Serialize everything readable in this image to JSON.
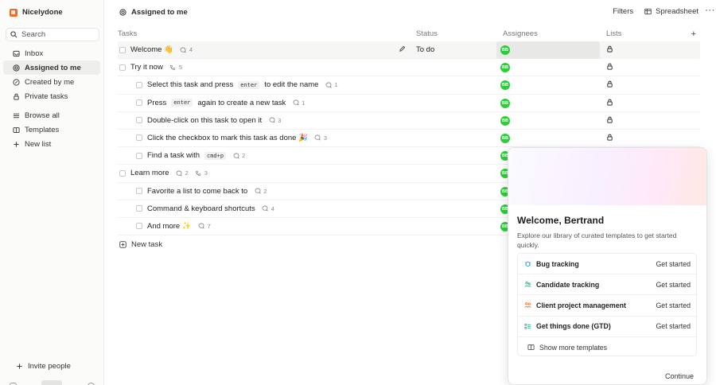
{
  "sidebar": {
    "workspace": "Nicelydone",
    "search_label": "Search",
    "items": [
      {
        "label": "Inbox",
        "icon": "inbox-icon"
      },
      {
        "label": "Assigned to me",
        "icon": "target-icon",
        "active": true
      },
      {
        "label": "Created by me",
        "icon": "pencil-circle-icon"
      },
      {
        "label": "Private tasks",
        "icon": "lock-icon"
      }
    ],
    "items2": [
      {
        "label": "Browse all",
        "icon": "list-icon"
      },
      {
        "label": "Templates",
        "icon": "book-icon"
      },
      {
        "label": "New list",
        "icon": "plus-icon"
      }
    ],
    "invite": "Invite people"
  },
  "header": {
    "title": "Assigned to me",
    "filters": "Filters",
    "spreadsheet": "Spreadsheet"
  },
  "table": {
    "columns": {
      "tasks": "Tasks",
      "status": "Status",
      "assignees": "Assignees",
      "lists": "Lists"
    },
    "status_first": "To do",
    "assignee_initials": "BB",
    "rows": [
      {
        "level": 0,
        "parts": [
          "Welcome 👋"
        ],
        "comments": "4"
      },
      {
        "level": 0,
        "parts": [
          "Try it now"
        ],
        "subtasks": "5"
      },
      {
        "level": 1,
        "parts": [
          "Select this task and press",
          "enter",
          "to edit the name"
        ],
        "kbd": [
          1
        ],
        "comments": "1"
      },
      {
        "level": 1,
        "parts": [
          "Press",
          "enter",
          "again to create a new task"
        ],
        "kbd": [
          1
        ],
        "comments": "1"
      },
      {
        "level": 1,
        "parts": [
          "Double-click on this task to open it"
        ],
        "comments": "3"
      },
      {
        "level": 1,
        "parts": [
          "Click the checkbox to mark this task as done 🎉"
        ],
        "comments": "3"
      },
      {
        "level": 1,
        "parts": [
          "Find a task with",
          "cmd+p"
        ],
        "kbd": [
          1
        ],
        "comments": "2"
      },
      {
        "level": 0,
        "parts": [
          "Learn more"
        ],
        "comments": "2",
        "subtasks": "3"
      },
      {
        "level": 1,
        "parts": [
          "Favorite a list to come back to"
        ],
        "comments": "2"
      },
      {
        "level": 1,
        "parts": [
          "Command & keyboard shortcuts"
        ],
        "comments": "4"
      },
      {
        "level": 1,
        "parts": [
          "And more ✨"
        ],
        "comments": "7"
      }
    ],
    "new_task": "New task"
  },
  "popup": {
    "title": "Welcome, Bertrand",
    "description": "Explore our library of curated templates to get started quickly.",
    "templates": [
      {
        "name": "Bug tracking",
        "icon": "bug-icon",
        "color": "#3aa0e0",
        "action": "Get started"
      },
      {
        "name": "Candidate tracking",
        "icon": "people-icon",
        "color": "#2bb58a",
        "action": "Get started"
      },
      {
        "name": "Client project management",
        "icon": "briefcase-icon",
        "color": "#f07a3a",
        "action": "Get started"
      },
      {
        "name": "Get things done (GTD)",
        "icon": "checklist-icon",
        "color": "#2bb58a",
        "action": "Get started"
      }
    ],
    "show_more": "Show more templates",
    "continue": "Continue"
  }
}
